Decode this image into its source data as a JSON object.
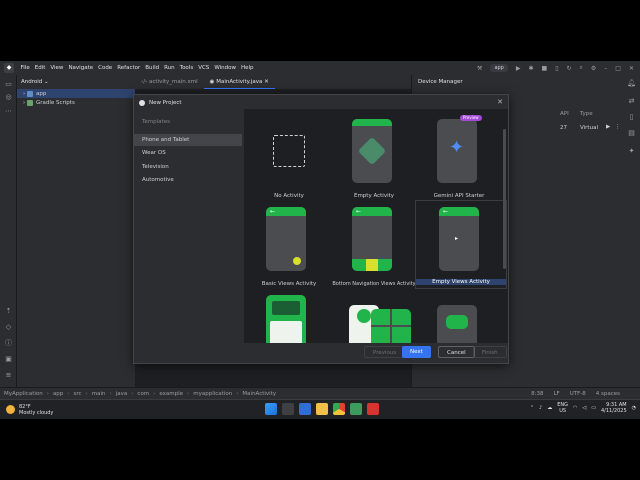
{
  "menu": {
    "items": [
      "File",
      "Edit",
      "View",
      "Navigate",
      "Code",
      "Refactor",
      "Build",
      "Run",
      "Tools",
      "VCS",
      "Window",
      "Help"
    ],
    "app_selector": "app"
  },
  "project": {
    "view_label": "Android",
    "tree": [
      {
        "label": "app"
      },
      {
        "label": "Gradle Scripts"
      }
    ]
  },
  "tabs": [
    {
      "label": "activity_main.xml"
    },
    {
      "label": "MainActivity.java"
    }
  ],
  "device_manager": {
    "title": "Device Manager",
    "col_api": "API",
    "col_type": "Type",
    "api_value": "27",
    "type_value": "Virtual"
  },
  "dialog": {
    "title": "New Project",
    "templates_label": "Templates",
    "categories": [
      "Phone and Tablet",
      "Wear OS",
      "Television",
      "Automotive"
    ],
    "selected_category": "Phone and Tablet",
    "templates": [
      {
        "name": "No Activity"
      },
      {
        "name": "Empty Activity"
      },
      {
        "name": "Gemini API Starter",
        "badge": "Preview"
      },
      {
        "name": "Basic Views Activity"
      },
      {
        "name": "Bottom Navigation Views Activity"
      },
      {
        "name": "Empty Views Activity"
      }
    ],
    "selected_template": "Empty Views Activity",
    "buttons": {
      "previous": "Previous",
      "next": "Next",
      "cancel": "Cancel",
      "finish": "Finish"
    }
  },
  "breadcrumb": [
    "MyApplication",
    "app",
    "src",
    "main",
    "java",
    "com",
    "example",
    "myapplication",
    "MainActivity"
  ],
  "status": {
    "position": "8:38",
    "line_sep": "LF",
    "encoding": "UTF-8",
    "indent": "4 spaces"
  },
  "taskbar": {
    "temperature": "82°F",
    "weather": "Mostly cloudy",
    "lang_line1": "ENG",
    "lang_line2": "US",
    "time": "9:31 AM",
    "date": "4/11/2025"
  },
  "colors": {
    "accent": "#3574f0",
    "android_green": "#21b44b",
    "bg": "#1e1f22",
    "panel": "#2b2d30"
  }
}
